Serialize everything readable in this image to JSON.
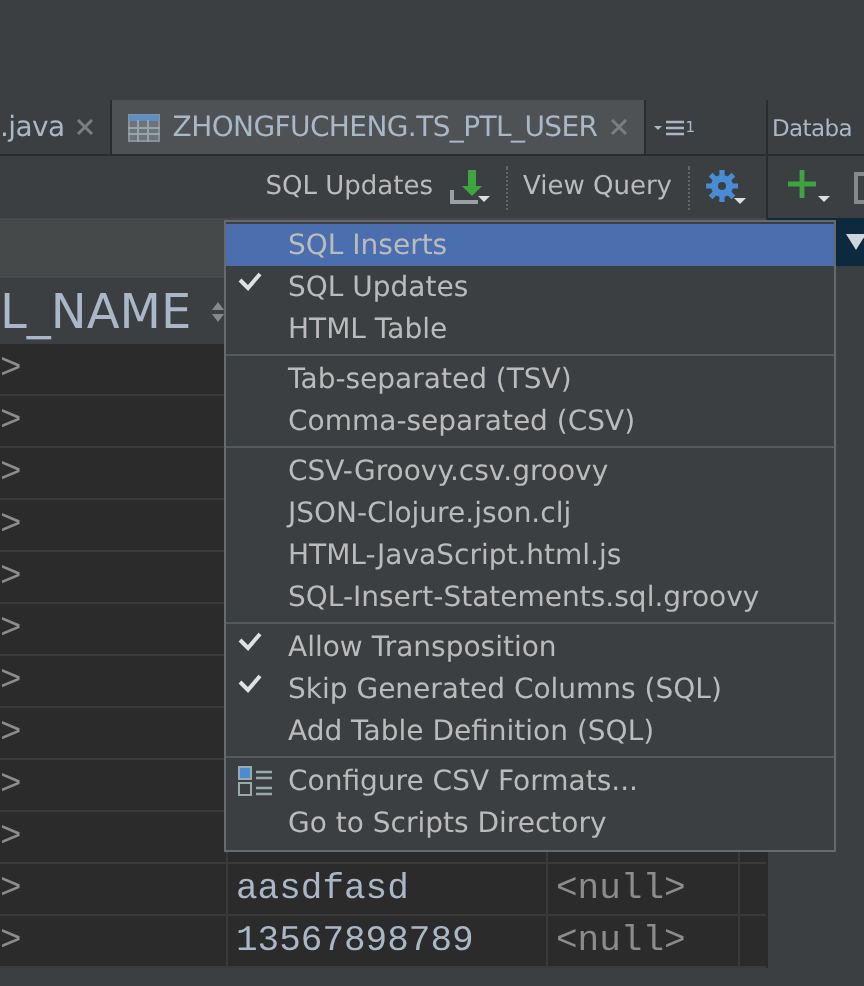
{
  "tabs": [
    {
      "label": ".java",
      "selected": false,
      "kind": "file"
    },
    {
      "label": "ZHONGFUCHENG.TS_PTL_USER",
      "selected": true,
      "kind": "table"
    }
  ],
  "tab_overflow": {
    "label": "1"
  },
  "side_panel": {
    "title": "Databa"
  },
  "toolbar": {
    "format": "SQL Updates",
    "view_query": "View Query"
  },
  "table": {
    "header": "L_NAME",
    "rows": [
      {
        "column_1": ">"
      },
      {
        "column_1": ">"
      },
      {
        "column_1": ">"
      },
      {
        "column_1": ">"
      },
      {
        "column_1": ">"
      },
      {
        "column_1": ">"
      },
      {
        "column_1": ">"
      },
      {
        "column_1": ">"
      },
      {
        "column_1": ">"
      },
      {
        "column_1": ">"
      },
      {
        "column_1": ">",
        "column_2": "aasdfasd",
        "column_3": "<null>"
      },
      {
        "column_1": ">",
        "column_2": "13567898789",
        "column_3": "<null>"
      }
    ]
  },
  "menu": {
    "sections": [
      {
        "items": [
          {
            "label": "SQL Inserts",
            "kind": "option",
            "checked": false,
            "selected": true
          },
          {
            "label": "SQL Updates",
            "kind": "option",
            "checked": true,
            "selected": false
          },
          {
            "label": "HTML Table",
            "kind": "option",
            "checked": false,
            "selected": false
          }
        ]
      },
      {
        "items": [
          {
            "label": "Tab-separated (TSV)",
            "kind": "option",
            "checked": false,
            "selected": false
          },
          {
            "label": "Comma-separated (CSV)",
            "kind": "option",
            "checked": false,
            "selected": false
          }
        ]
      },
      {
        "items": [
          {
            "label": "CSV-Groovy.csv.groovy",
            "kind": "option",
            "checked": false,
            "selected": false
          },
          {
            "label": "JSON-Clojure.json.clj",
            "kind": "option",
            "checked": false,
            "selected": false
          },
          {
            "label": "HTML-JavaScript.html.js",
            "kind": "option",
            "checked": false,
            "selected": false
          },
          {
            "label": "SQL-Insert-Statements.sql.groovy",
            "kind": "option",
            "checked": false,
            "selected": false
          }
        ]
      },
      {
        "items": [
          {
            "label": "Allow Transposition",
            "kind": "option",
            "checked": true,
            "selected": false
          },
          {
            "label": "Skip Generated Columns (SQL)",
            "kind": "option",
            "checked": true,
            "selected": false
          },
          {
            "label": "Add Table Definition (SQL)",
            "kind": "option",
            "checked": false,
            "selected": false
          }
        ]
      },
      {
        "items": [
          {
            "label": "Configure CSV Formats...",
            "kind": "settings",
            "selected": false
          },
          {
            "label": "Go to Scripts Directory",
            "kind": "option",
            "checked": false,
            "selected": false
          }
        ]
      }
    ]
  }
}
